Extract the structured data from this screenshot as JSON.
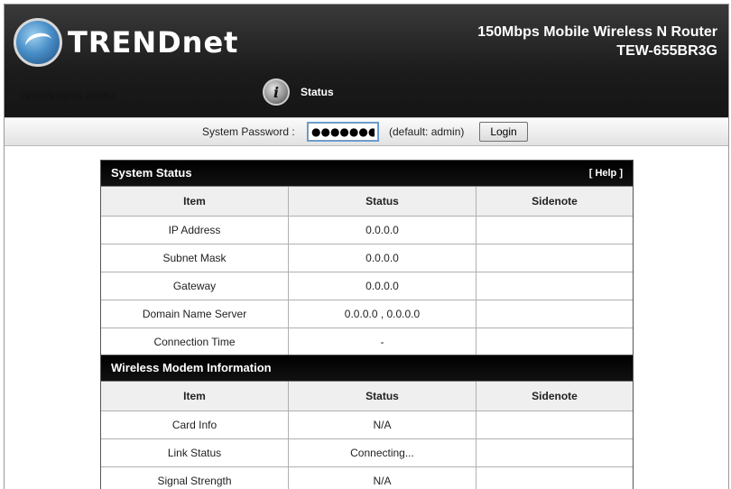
{
  "header": {
    "brand": "TRENDnet",
    "product_line1": "150Mbps Mobile Wireless N Router",
    "product_line2": "TEW-655BR3G",
    "menu_title": "USER's MAIN MENU",
    "status_link": "Status"
  },
  "login": {
    "label": "System Password :",
    "value": "●●●●●●●",
    "default_hint": "(default: admin)",
    "button": "Login"
  },
  "system_status": {
    "title": "System Status",
    "help": "[ Help ]",
    "columns": [
      "Item",
      "Status",
      "Sidenote"
    ],
    "rows": [
      {
        "item": "IP Address",
        "status": "0.0.0.0",
        "sidenote": ""
      },
      {
        "item": "Subnet Mask",
        "status": "0.0.0.0",
        "sidenote": ""
      },
      {
        "item": "Gateway",
        "status": "0.0.0.0",
        "sidenote": ""
      },
      {
        "item": "Domain Name Server",
        "status": "0.0.0.0 , 0.0.0.0",
        "sidenote": ""
      },
      {
        "item": "Connection Time",
        "status": "-",
        "sidenote": ""
      }
    ]
  },
  "modem_info": {
    "title": "Wireless Modem Information",
    "columns": [
      "Item",
      "Status",
      "Sidenote"
    ],
    "rows": [
      {
        "item": "Card Info",
        "status": "N/A",
        "sidenote": ""
      },
      {
        "item": "Link Status",
        "status": "Connecting...",
        "sidenote": ""
      },
      {
        "item": "Signal Strength",
        "status": "N/A",
        "sidenote": ""
      }
    ]
  }
}
